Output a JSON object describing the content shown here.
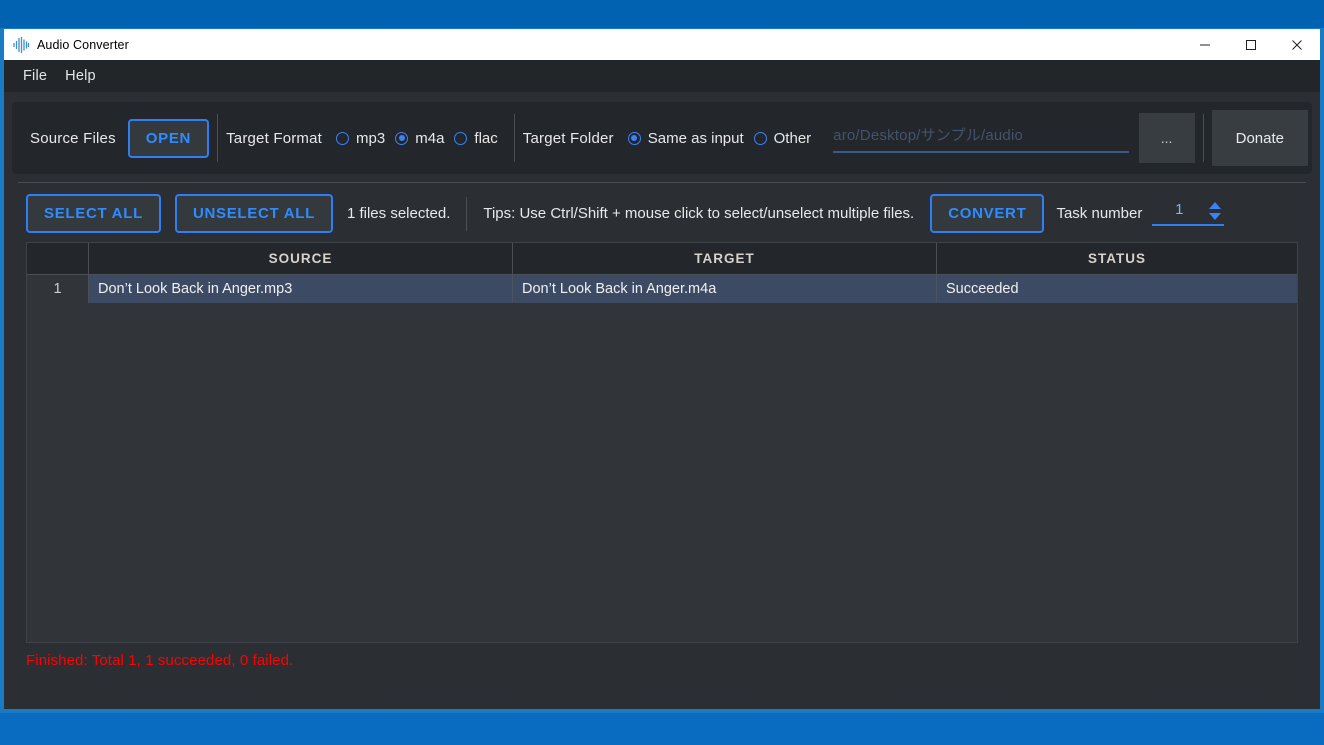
{
  "window": {
    "title": "Audio Converter",
    "app_icon": "audio-waveform-icon",
    "minimize": "–",
    "maximize": "☐",
    "close": "✕"
  },
  "menubar": {
    "items": [
      {
        "label": "File"
      },
      {
        "label": "Help"
      }
    ]
  },
  "toolbar": {
    "source_files_label": "Source Files",
    "open_button": "OPEN",
    "target_format_label": "Target Format",
    "formats": [
      {
        "label": "mp3",
        "checked": false
      },
      {
        "label": "m4a",
        "checked": true
      },
      {
        "label": "flac",
        "checked": false
      }
    ],
    "target_folder_label": "Target Folder",
    "folder_options": [
      {
        "label": "Same as input",
        "checked": true
      },
      {
        "label": "Other",
        "checked": false
      }
    ],
    "path_value": "aro/Desktop/サンプル/audio",
    "browse_button": "...",
    "donate_button": "Donate"
  },
  "actions": {
    "select_all": "SELECT ALL",
    "unselect_all": "UNSELECT ALL",
    "files_selected": "1 files selected.",
    "tips": "Tips: Use Ctrl/Shift + mouse click to select/unselect multiple files.",
    "convert": "CONVERT",
    "task_number_label": "Task number",
    "task_number_value": "1"
  },
  "table": {
    "columns": [
      "",
      "SOURCE",
      "TARGET",
      "STATUS"
    ],
    "rows": [
      {
        "index": "1",
        "source": "Don’t Look Back in Anger.mp3",
        "target": "Don’t Look Back in Anger.m4a",
        "status": "Succeeded"
      }
    ]
  },
  "status": {
    "message": "Finished: Total 1, 1 succeeded, 0 failed."
  },
  "colors": {
    "accent_blue": "#2f7ef6",
    "window_border": "#1b7ac4",
    "panel_bg": "#23272b",
    "app_bg": "#2b2f33",
    "row_selected": "#3c4a63",
    "error_red": "#ff0000",
    "disabled_text": "#43536e"
  }
}
